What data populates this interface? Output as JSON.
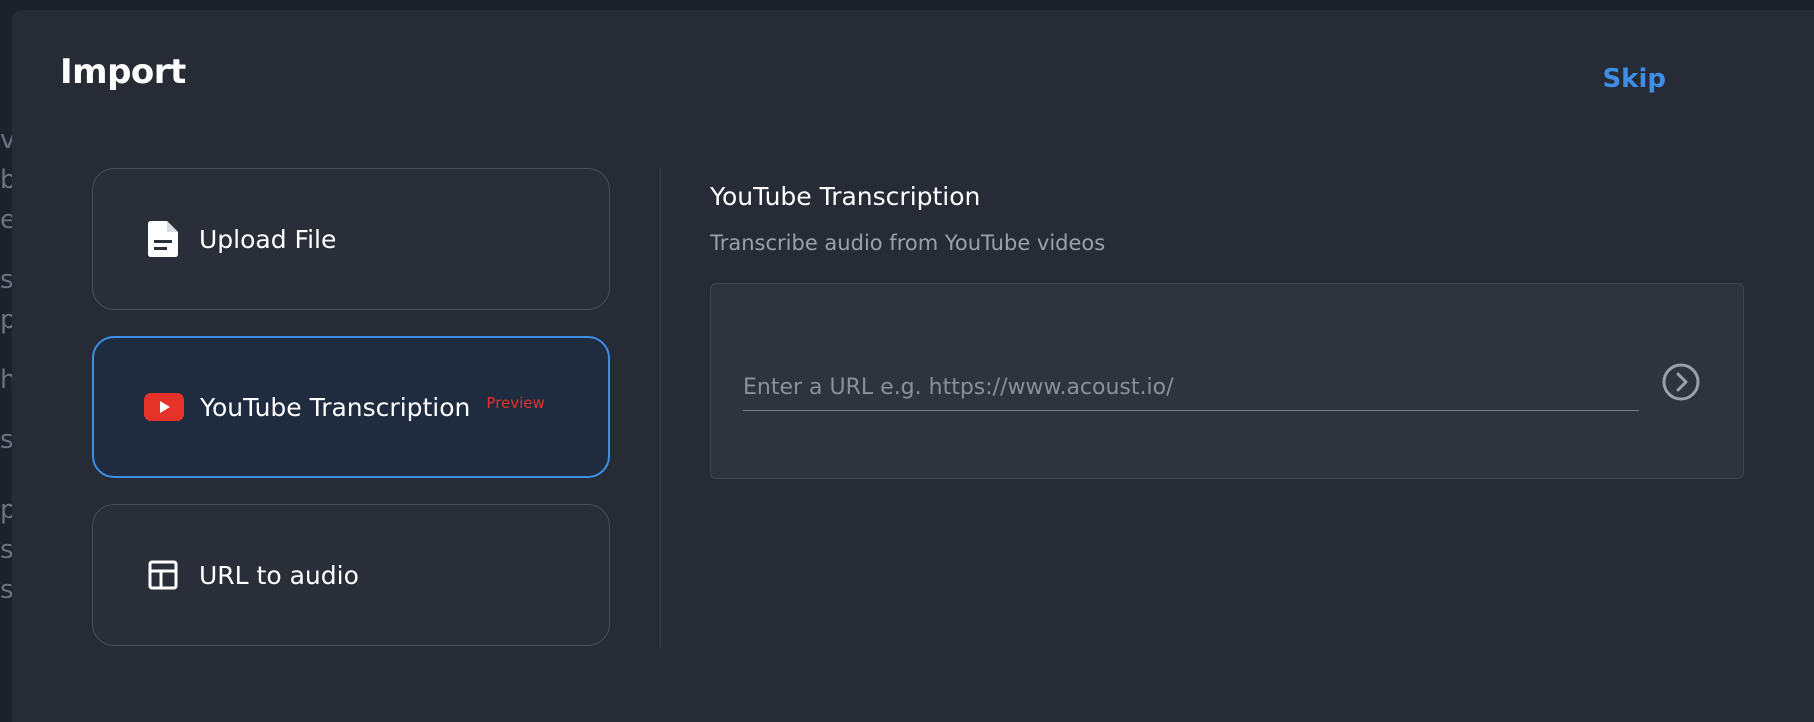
{
  "background": {
    "fragments": [
      "va",
      "ba",
      "er",
      "s",
      "p",
      "h",
      "s",
      "p",
      "s!",
      "s,"
    ]
  },
  "modal": {
    "title": "Import",
    "skip_label": "Skip"
  },
  "options": [
    {
      "label": "Upload File",
      "icon": "document-icon"
    },
    {
      "label": "YouTube Transcription",
      "icon": "youtube-icon",
      "badge": "Preview",
      "selected": true
    },
    {
      "label": "URL to audio",
      "icon": "layout-icon"
    }
  ],
  "panel": {
    "title": "YouTube Transcription",
    "subtitle": "Transcribe audio from YouTube videos",
    "url_placeholder": "Enter a URL e.g. https://www.acoust.io/",
    "submit_icon": "arrow-circle-right-icon"
  },
  "colors": {
    "accent": "#3d8fe6",
    "badge": "#e5332a",
    "youtube": "#e5332a",
    "modal_bg": "#262b36"
  }
}
